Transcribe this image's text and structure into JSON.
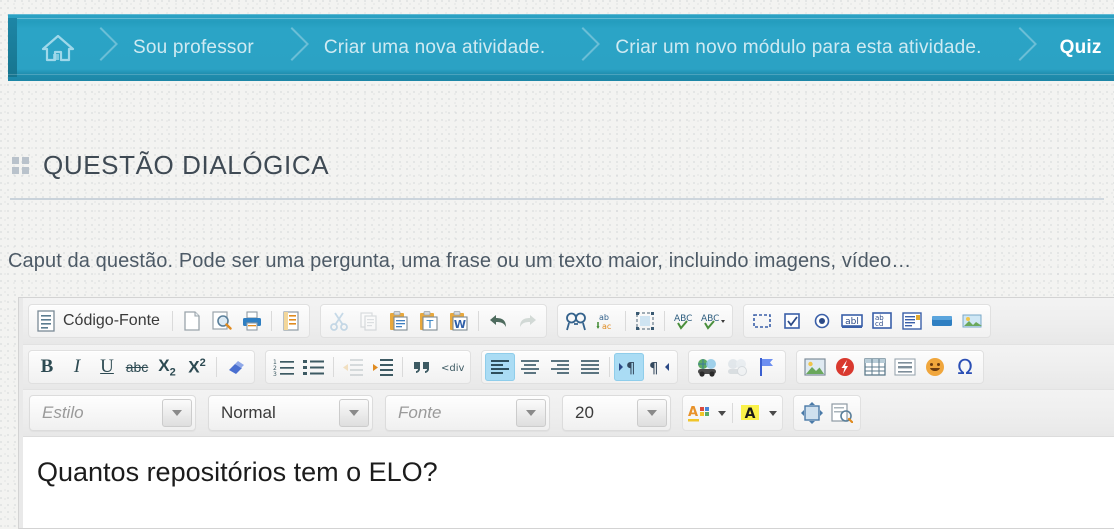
{
  "breadcrumb": {
    "home_icon": "home-icon",
    "items": [
      {
        "label": "Sou professor",
        "current": false
      },
      {
        "label": "Criar uma nova atividade.",
        "current": false
      },
      {
        "label": "Criar um novo módulo para esta atividade.",
        "current": false
      },
      {
        "label": "Quiz",
        "current": true
      }
    ]
  },
  "section": {
    "grip_icon": "grip-icon",
    "title": "QUESTÃO DIALÓGICA"
  },
  "caption": "Caput da questão. Pode ser uma pergunta, uma frase ou um texto maior, incluindo imagens, vídeo…",
  "editor": {
    "source_button": {
      "label": "Código-Fonte",
      "icon": "source-code-icon"
    },
    "row1_icons": [
      "new-page-icon",
      "preview-icon",
      "print-icon",
      "templates-icon",
      "cut-icon",
      "copy-icon",
      "paste-icon",
      "paste-text-icon",
      "paste-word-icon",
      "undo-icon",
      "redo-icon",
      "find-icon",
      "replace-icon",
      "select-all-icon",
      "spellcheck-icon",
      "spellcheck-options-icon",
      "form-icon",
      "checkbox-icon",
      "radio-button-icon",
      "text-field-icon",
      "textarea-icon",
      "select-field-icon",
      "button-icon",
      "image-button-icon"
    ],
    "row2_icons": [
      "bold-icon",
      "italic-icon",
      "underline-icon",
      "strikethrough-icon",
      "subscript-icon",
      "superscript-icon",
      "remove-format-icon",
      "numbered-list-icon",
      "bulleted-list-icon",
      "outdent-icon",
      "indent-icon",
      "blockquote-icon",
      "div-container-icon",
      "align-left-icon",
      "align-center-icon",
      "align-right-icon",
      "justify-icon",
      "text-direction-ltr-icon",
      "text-direction-rtl-icon",
      "link-icon",
      "unlink-icon",
      "anchor-icon",
      "image-icon",
      "flash-icon",
      "table-icon",
      "horizontal-rule-icon",
      "smiley-icon",
      "special-character-icon"
    ],
    "style_select": {
      "value": "Estilo",
      "is_placeholder": true
    },
    "format_select": {
      "value": "Normal",
      "is_placeholder": false
    },
    "font_select": {
      "value": "Fonte",
      "is_placeholder": true
    },
    "size_select": {
      "value": "20",
      "is_placeholder": false
    },
    "color_buttons": [
      "text-color-icon",
      "background-color-icon"
    ],
    "view_buttons": [
      "maximize-icon",
      "show-blocks-icon"
    ],
    "content": "Quantos repositórios tem o ELO?"
  },
  "colors": {
    "breadcrumb_bg": "#2ba2c4",
    "breadcrumb_text": "#cfeaf2",
    "breadcrumb_active_text": "#ffffff",
    "page_bg": "#f3f3f1",
    "title_text": "#3f4a54",
    "caption_text": "#4d5a66",
    "toolbar_active": "#aadcf4"
  }
}
